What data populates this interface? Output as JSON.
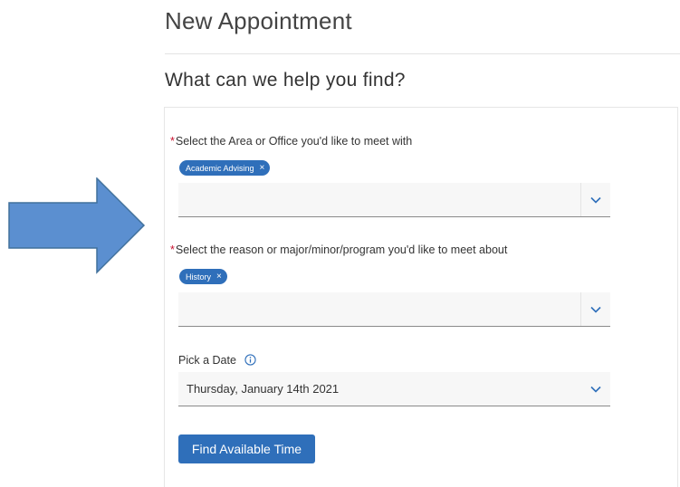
{
  "page": {
    "title": "New Appointment"
  },
  "section": {
    "title": "What can we help you find?"
  },
  "form": {
    "area_field": {
      "required_mark": "*",
      "label": "Select the Area or Office you'd like to meet with",
      "chip_label": "Academic Advising",
      "chip_remove": "×",
      "value": ""
    },
    "reason_field": {
      "required_mark": "*",
      "label": "Select the reason or major/minor/program you'd like to meet about",
      "chip_label": "History",
      "chip_remove": "×",
      "value": ""
    },
    "date_field": {
      "label": "Pick a Date",
      "value": "Thursday, January 14th 2021"
    },
    "submit_label": "Find Available Time"
  },
  "annotation": {
    "arrow_color": "#5b8fd0"
  },
  "colors": {
    "accent": "#2f6fba",
    "required": "#c8102e"
  }
}
